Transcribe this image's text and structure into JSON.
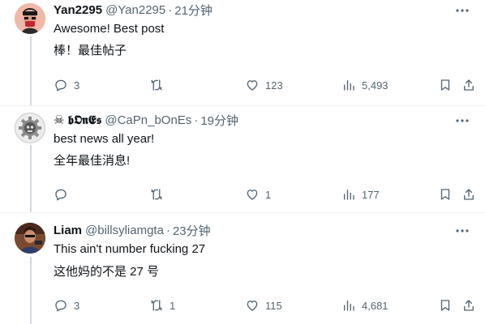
{
  "posts": [
    {
      "name": "Yan2295",
      "handle": "@Yan2295",
      "time": "21分钟",
      "text_en": "Awesome! Best post",
      "text_zh": "棒！最佳帖子",
      "replies": "3",
      "reposts": "",
      "likes": "123",
      "views": "5,493"
    },
    {
      "name": "☠ 𝖇𝕺𝖓𝕰𝖘",
      "handle": "@CaPn_bOnEs",
      "time": "19分钟",
      "text_en": "best news all year!",
      "text_zh": "全年最佳消息!",
      "replies": "",
      "reposts": "",
      "likes": "1",
      "views": "177"
    },
    {
      "name": "Liam",
      "handle": "@billsyliamgta",
      "time": "23分钟",
      "text_en": "This ain't number fucking 27",
      "text_zh": "这他妈的不是 27 号",
      "replies": "3",
      "reposts": "1",
      "likes": "115",
      "views": "4,681"
    }
  ],
  "separator": "·",
  "colors": {
    "secondary_text": "#536471",
    "divider": "#eff3f4",
    "thread_line": "#cfd9de"
  },
  "icons": [
    "reply-icon",
    "repost-icon",
    "like-icon",
    "views-icon",
    "bookmark-icon",
    "share-icon",
    "more-icon"
  ]
}
